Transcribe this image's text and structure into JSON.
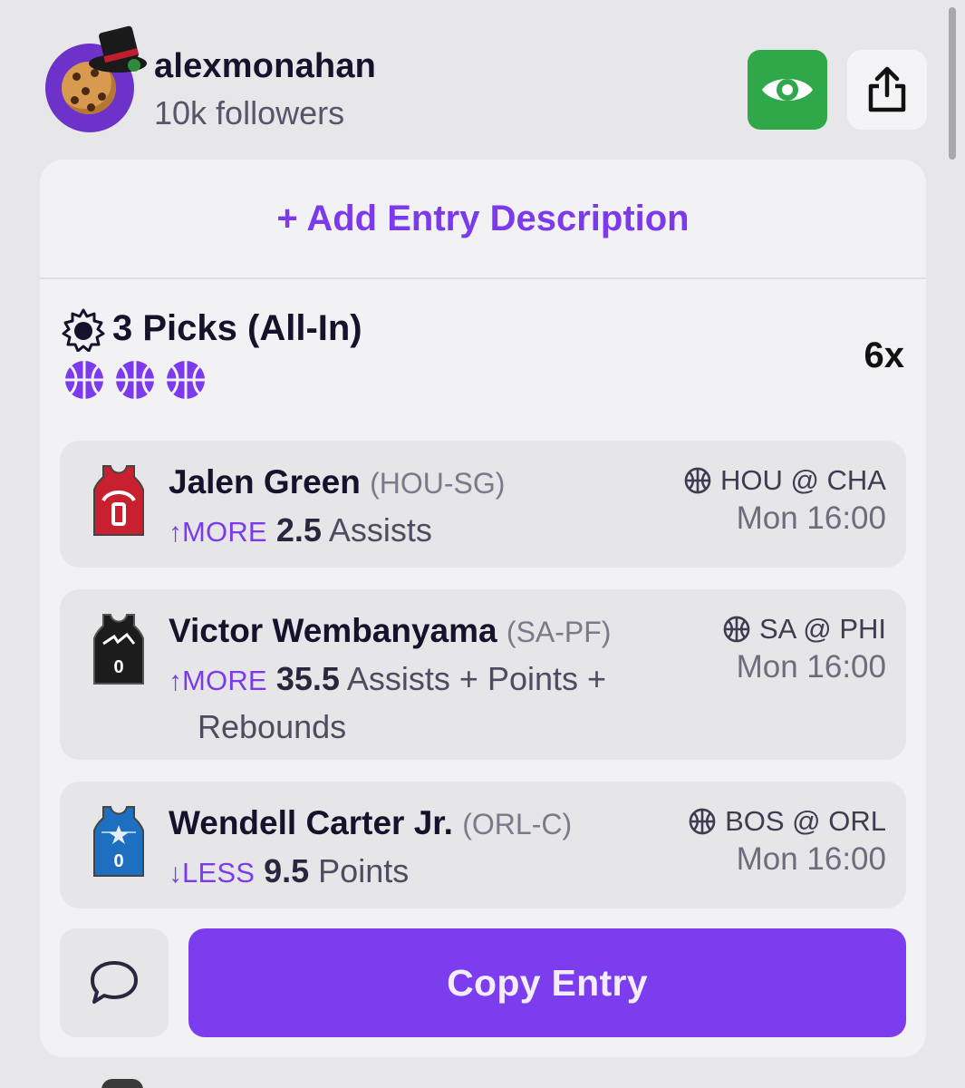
{
  "profile": {
    "username": "alexmonahan",
    "followers": "10k followers",
    "avatar_icon": "cookie-with-top-hat"
  },
  "actions": {
    "watch_icon": "eye-icon",
    "watch_color": "#2fa84a",
    "share_icon": "share-icon"
  },
  "entry": {
    "description_link": "+ Add Entry Description",
    "title": "3 Picks (All-In)",
    "multiplier": "6x",
    "sport_icon_count": 3,
    "accent_color": "#7c3aed",
    "picks": [
      {
        "player": "Jalen Green",
        "team_pos": "(HOU-SG)",
        "direction": "MORE",
        "value": "2.5",
        "stat_line1": "Assists",
        "stat_line2": "",
        "matchup": "HOU @ CHA",
        "time": "Mon 16:00",
        "jersey_color": "#c8202f",
        "jersey_number": "0"
      },
      {
        "player": "Victor Wembanyama",
        "team_pos": "(SA-PF)",
        "direction": "MORE",
        "value": "35.5",
        "stat_line1": "Assists + Points +",
        "stat_line2": "Rebounds",
        "matchup": "SA @ PHI",
        "time": "Mon 16:00",
        "jersey_color": "#1c1c1c",
        "jersey_number": "0"
      },
      {
        "player": "Wendell Carter Jr.",
        "team_pos": "(ORL-C)",
        "direction": "LESS",
        "value": "9.5",
        "stat_line1": "Points",
        "stat_line2": "",
        "matchup": "BOS @ ORL",
        "time": "Mon 16:00",
        "jersey_color": "#1f6fc0",
        "jersey_number": "0"
      }
    ]
  },
  "footer": {
    "comment_icon": "comment-icon",
    "copy_label": "Copy Entry"
  }
}
